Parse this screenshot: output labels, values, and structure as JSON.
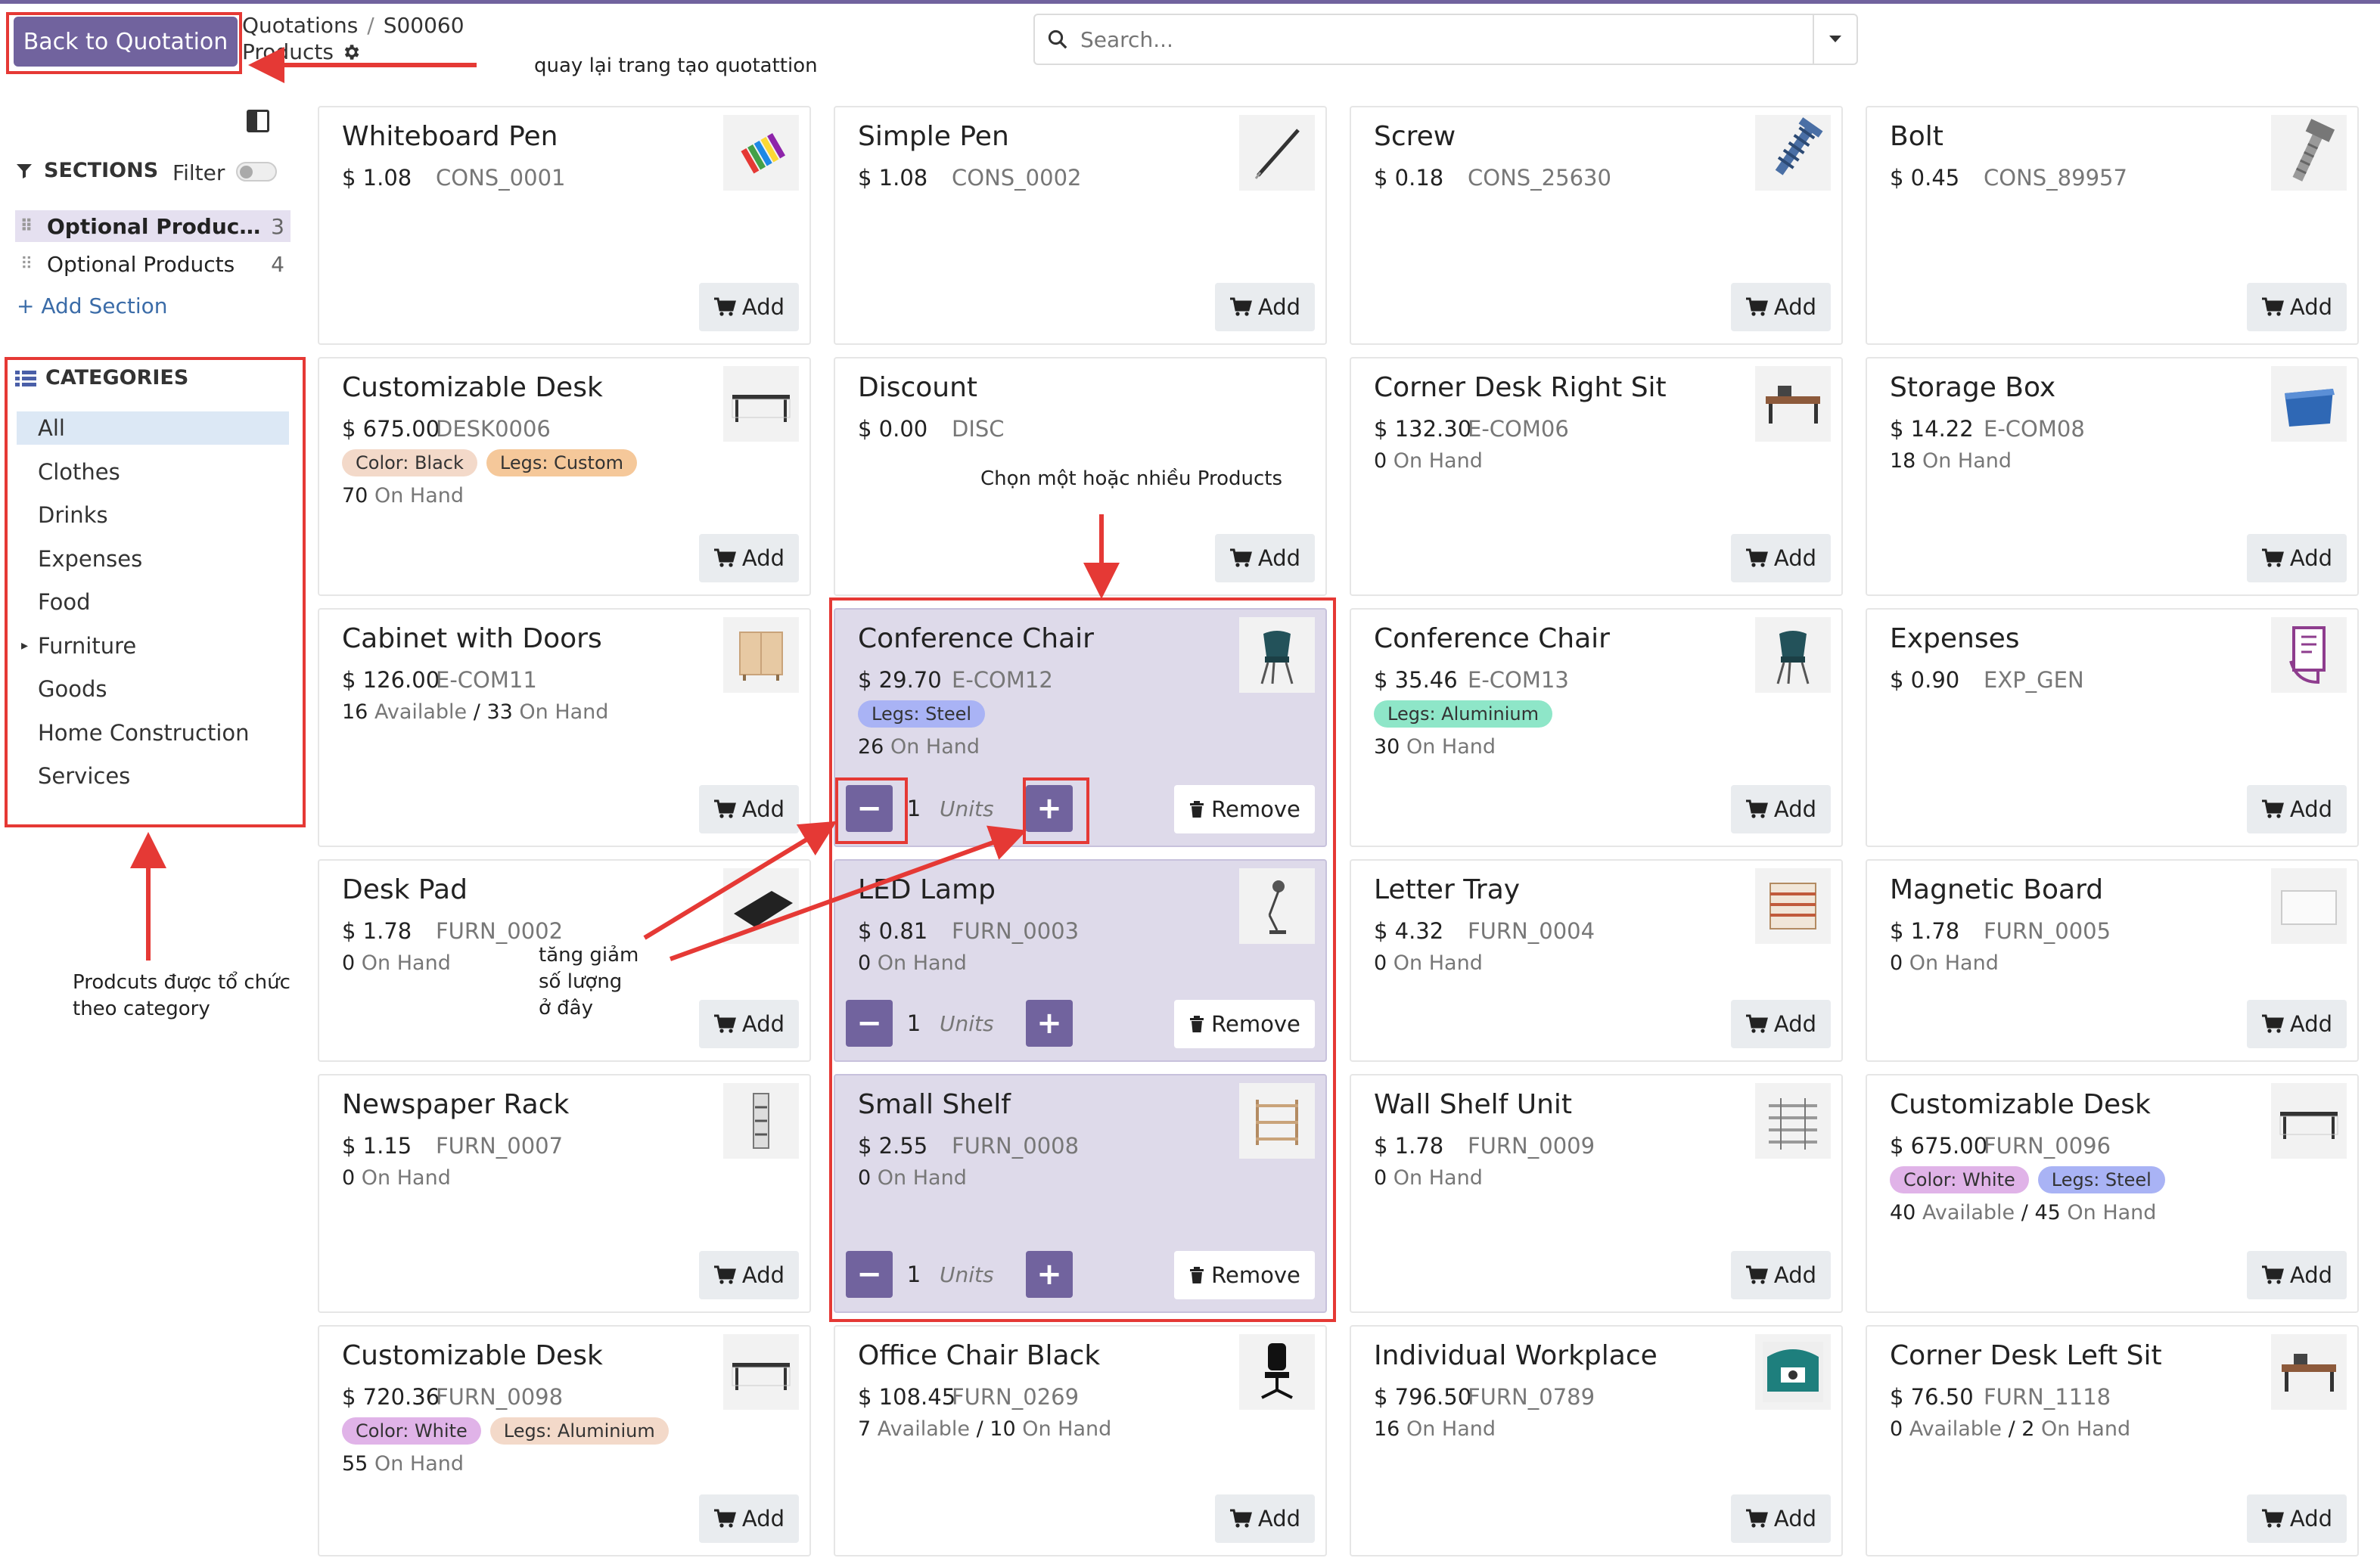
{
  "header": {
    "back_label": "Back to Quotation",
    "breadcrumb": [
      "Quotations",
      "S00060"
    ],
    "subtitle": "Products"
  },
  "search": {
    "placeholder": "Search..."
  },
  "sidebar": {
    "sections_title": "SECTIONS",
    "filter_label": "Filter",
    "sections": [
      {
        "label": "Optional Product...",
        "count": "3",
        "active": true
      },
      {
        "label": "Optional Products",
        "count": "4",
        "active": false
      }
    ],
    "add_section": "+ Add Section",
    "categories_title": "CATEGORIES",
    "categories": [
      "All",
      "Clothes",
      "Drinks",
      "Expenses",
      "Food",
      "Furniture",
      "Goods",
      "Home Construction",
      "Services"
    ]
  },
  "labels": {
    "add": "Add",
    "remove": "Remove",
    "units": "Units",
    "on_hand": "On Hand",
    "available": "Available"
  },
  "products": [
    {
      "name": "Whiteboard Pen",
      "price": "$ 1.08",
      "code": "CONS_0001",
      "icon": "pens-icon"
    },
    {
      "name": "Simple Pen",
      "price": "$ 1.08",
      "code": "CONS_0002",
      "icon": "pen-icon"
    },
    {
      "name": "Screw",
      "price": "$ 0.18",
      "code": "CONS_25630",
      "icon": "screw-icon"
    },
    {
      "name": "Bolt",
      "price": "$ 0.45",
      "code": "CONS_89957",
      "icon": "bolt-icon"
    },
    {
      "name": "Customizable Desk",
      "price": "$ 675.00",
      "code": "DESK0006",
      "tags": [
        {
          "text": "Color: Black",
          "color": "#f3d9c9"
        },
        {
          "text": "Legs: Custom",
          "color": "#f5c89a"
        }
      ],
      "stock": "70",
      "icon": "desk-icon"
    },
    {
      "name": "Discount",
      "price": "$ 0.00",
      "code": "DISC"
    },
    {
      "name": "Corner Desk Right Sit",
      "price": "$ 132.30",
      "code": "E-COM06",
      "stock": "0",
      "icon": "corner-desk-icon"
    },
    {
      "name": "Storage Box",
      "price": "$ 14.22",
      "code": "E-COM08",
      "stock": "18",
      "icon": "storage-box-icon"
    },
    {
      "name": "Cabinet with Doors",
      "price": "$ 126.00",
      "code": "E-COM11",
      "available": "16",
      "stock": "33",
      "icon": "cabinet-icon"
    },
    {
      "name": "Conference Chair",
      "price": "$ 29.70",
      "code": "E-COM12",
      "tags": [
        {
          "text": "Legs: Steel",
          "color": "#a9b3f5"
        }
      ],
      "stock": "26",
      "selected": true,
      "qty": "1",
      "icon": "chair-icon"
    },
    {
      "name": "Conference Chair",
      "price": "$ 35.46",
      "code": "E-COM13",
      "tags": [
        {
          "text": "Legs: Aluminium",
          "color": "#8ee6c8"
        }
      ],
      "stock": "30",
      "icon": "chair-icon"
    },
    {
      "name": "Expenses",
      "price": "$ 0.90",
      "code": "EXP_GEN",
      "icon": "expenses-icon"
    },
    {
      "name": "Desk Pad",
      "price": "$ 1.78",
      "code": "FURN_0002",
      "stock": "0",
      "icon": "desk-pad-icon"
    },
    {
      "name": "LED Lamp",
      "price": "$ 0.81",
      "code": "FURN_0003",
      "stock": "0",
      "selected": true,
      "qty": "1",
      "icon": "lamp-icon"
    },
    {
      "name": "Letter Tray",
      "price": "$ 4.32",
      "code": "FURN_0004",
      "stock": "0",
      "icon": "letter-tray-icon"
    },
    {
      "name": "Magnetic Board",
      "price": "$ 1.78",
      "code": "FURN_0005",
      "stock": "0",
      "icon": "board-icon"
    },
    {
      "name": "Newspaper Rack",
      "price": "$ 1.15",
      "code": "FURN_0007",
      "stock": "0",
      "icon": "rack-icon"
    },
    {
      "name": "Small Shelf",
      "price": "$ 2.55",
      "code": "FURN_0008",
      "stock": "0",
      "selected": true,
      "qty": "1",
      "icon": "shelf-icon"
    },
    {
      "name": "Wall Shelf Unit",
      "price": "$ 1.78",
      "code": "FURN_0009",
      "stock": "0",
      "icon": "wall-shelf-icon"
    },
    {
      "name": "Customizable Desk",
      "price": "$ 675.00",
      "code": "FURN_0096",
      "tags": [
        {
          "text": "Color: White",
          "color": "#e0b3e8"
        },
        {
          "text": "Legs: Steel",
          "color": "#a9b3f5"
        }
      ],
      "available": "40",
      "stock": "45",
      "icon": "desk-icon"
    },
    {
      "name": "Customizable Desk",
      "price": "$ 720.36",
      "code": "FURN_0098",
      "tags": [
        {
          "text": "Color: White",
          "color": "#e0b3e8"
        },
        {
          "text": "Legs: Aluminium",
          "color": "#f3d9c9"
        }
      ],
      "stock": "55",
      "icon": "desk-icon"
    },
    {
      "name": "Office Chair Black",
      "price": "$ 108.45",
      "code": "FURN_0269",
      "available": "7",
      "stock": "10",
      "icon": "office-chair-icon"
    },
    {
      "name": "Individual Workplace",
      "price": "$ 796.50",
      "code": "FURN_0789",
      "stock": "16",
      "icon": "workplace-icon"
    },
    {
      "name": "Corner Desk Left Sit",
      "price": "$ 76.50",
      "code": "FURN_1118",
      "available": "0",
      "stock": "2",
      "icon": "corner-desk-icon"
    }
  ],
  "annotations": {
    "back": "quay lại trang tạo quotattion",
    "select": "Chọn một hoặc nhiều Products",
    "qty": [
      "tăng giảm",
      "số lượng",
      "ở đây"
    ],
    "category": [
      "Prodcuts được tổ chức",
      "theo category"
    ]
  },
  "colors": {
    "primary": "#71639e",
    "annotation": "#e53935"
  }
}
